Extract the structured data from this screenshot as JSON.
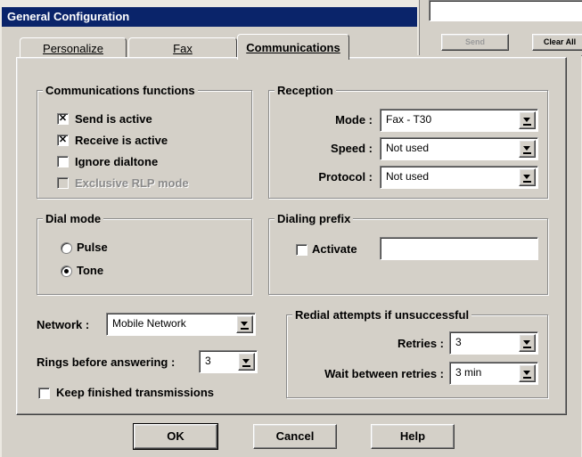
{
  "window": {
    "title": "General Configuration"
  },
  "background_window": {
    "send_label": "Send",
    "clear_all_label": "Clear All"
  },
  "tabs": [
    {
      "label": "Personalize"
    },
    {
      "label": "Fax"
    },
    {
      "label": "Communications",
      "active": true
    }
  ],
  "comm_functions": {
    "title": "Communications functions",
    "items": [
      {
        "label": "Send is active",
        "checked": true,
        "disabled": false
      },
      {
        "label": "Receive is active",
        "checked": true,
        "disabled": false
      },
      {
        "label": "Ignore dialtone",
        "checked": false,
        "disabled": false
      },
      {
        "label": "Exclusive RLP mode",
        "checked": false,
        "disabled": true
      }
    ]
  },
  "reception": {
    "title": "Reception",
    "mode_label": "Mode :",
    "mode_value": "Fax - T30",
    "speed_label": "Speed :",
    "speed_value": "Not used",
    "protocol_label": "Protocol :",
    "protocol_value": "Not used"
  },
  "dial_mode": {
    "title": "Dial mode",
    "pulse_label": "Pulse",
    "tone_label": "Tone",
    "selected": "Tone"
  },
  "dialing_prefix": {
    "title": "Dialing prefix",
    "activate_label": "Activate",
    "activate_checked": false,
    "value": ""
  },
  "network": {
    "label": "Network :",
    "value": "Mobile Network"
  },
  "rings": {
    "label": "Rings before answering :",
    "value": "3"
  },
  "keep_finished": {
    "label": "Keep finished transmissions",
    "checked": false
  },
  "redial": {
    "title": "Redial attempts if unsuccessful",
    "retries_label": "Retries :",
    "retries_value": "3",
    "wait_label": "Wait between retries :",
    "wait_value": "3 min"
  },
  "buttons": {
    "ok": "OK",
    "cancel": "Cancel",
    "help": "Help"
  },
  "colors": {
    "titlebar": "#0a246a",
    "face": "#d4d0c8",
    "disabled_text": "#8a8a8a"
  }
}
